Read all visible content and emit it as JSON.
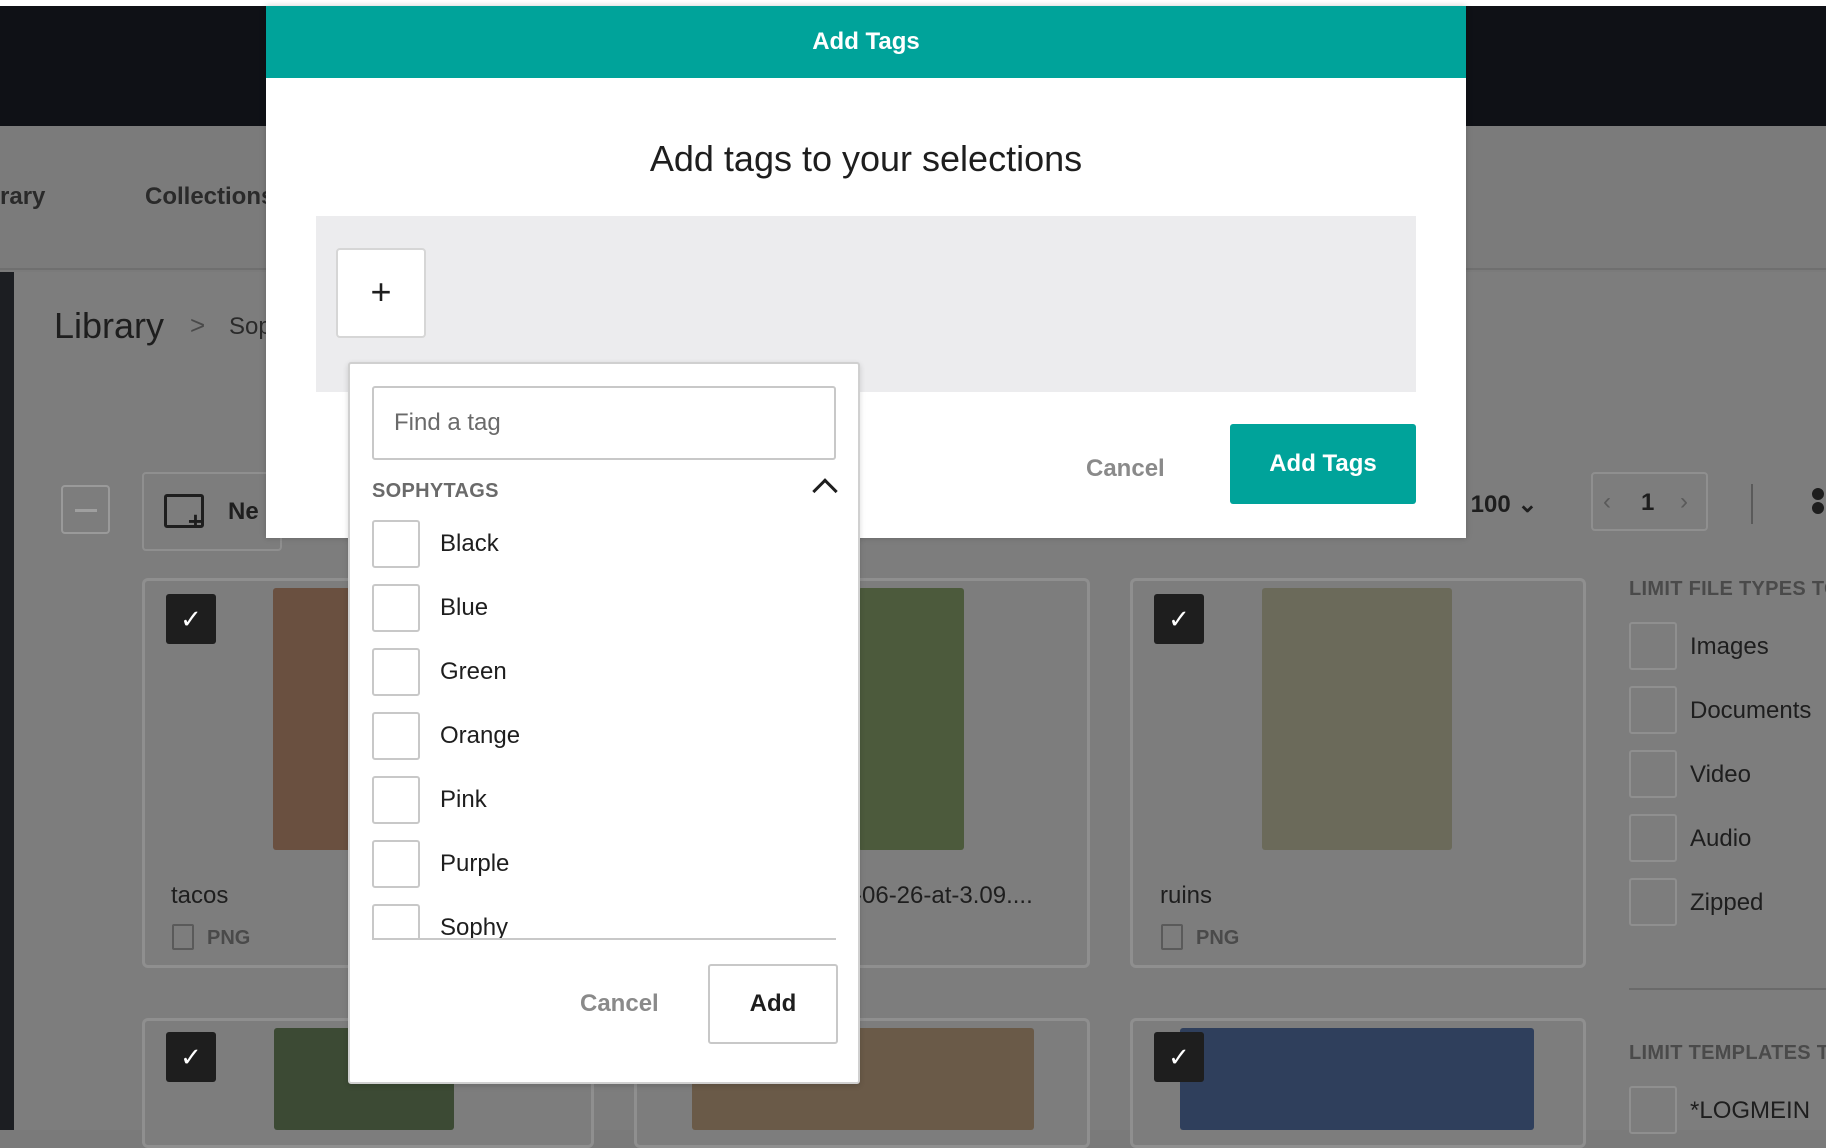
{
  "nav": {
    "library_tab": "rary",
    "collections_tab": "Collections"
  },
  "breadcrumb": {
    "root": "Library",
    "separator": ">",
    "current": "Sop"
  },
  "toolbar": {
    "new_label": "Ne",
    "sort_label": ": 100",
    "page_number": "1"
  },
  "cards": [
    {
      "name": "tacos",
      "type": "PNG",
      "thumb_color": "#6a5040"
    },
    {
      "name": "-06-26-at-3.09....",
      "type": "",
      "thumb_color": "#4c5a3c"
    },
    {
      "name": "ruins",
      "type": "PNG",
      "thumb_color": "#6b6a5a"
    },
    {
      "name": "",
      "type": "",
      "thumb_color": "#3c4a34"
    },
    {
      "name": "",
      "type": "",
      "thumb_color": "#6a5a48"
    },
    {
      "name": "",
      "type": "",
      "thumb_color": "#2f3f5c"
    }
  ],
  "sidebar": {
    "file_types_heading": "LIMIT FILE TYPES TO",
    "file_types": [
      "Images",
      "Documents",
      "Video",
      "Audio",
      "Zipped"
    ],
    "templates_heading": "LIMIT TEMPLATES TO",
    "templates": [
      "*LOGMEIN"
    ]
  },
  "modal": {
    "header": "Add Tags",
    "title": "Add tags to your selections",
    "plus_label": "+",
    "cancel_label": "Cancel",
    "submit_label": "Add Tags",
    "accent_color": "#00a39a"
  },
  "dropdown": {
    "search_placeholder": "Find a tag",
    "group_heading": "SOPHYTAGS",
    "tags": [
      "Black",
      "Blue",
      "Green",
      "Orange",
      "Pink",
      "Purple",
      "Sophy"
    ],
    "cancel_label": "Cancel",
    "add_label": "Add"
  }
}
